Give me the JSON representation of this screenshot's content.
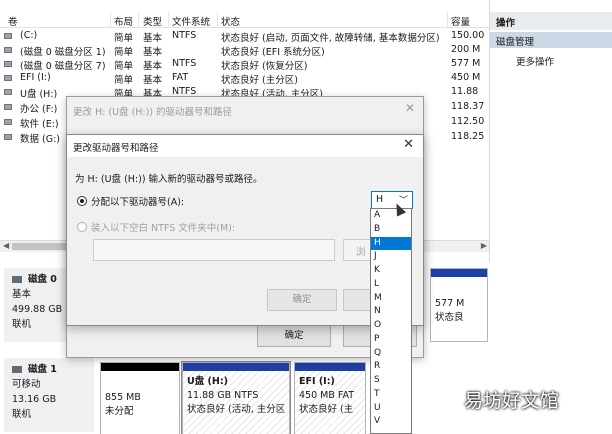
{
  "columns": [
    "卷",
    "布局",
    "类型",
    "文件系统",
    "状态",
    "容量"
  ],
  "volumes": [
    {
      "name": "(C:)",
      "layout": "简单",
      "type": "基本",
      "fs": "NTFS",
      "status": "状态良好 (启动, 页面文件, 故障转储, 基本数据分区)",
      "capacity": "150.00"
    },
    {
      "name": "(磁盘 0 磁盘分区 1)",
      "layout": "简单",
      "type": "基本",
      "fs": "",
      "status": "状态良好 (EFI 系统分区)",
      "capacity": "200 M"
    },
    {
      "name": "(磁盘 0 磁盘分区 7)",
      "layout": "简单",
      "type": "基本",
      "fs": "NTFS",
      "status": "状态良好 (恢复分区)",
      "capacity": "577 M"
    },
    {
      "name": "EFI (I:)",
      "layout": "简单",
      "type": "基本",
      "fs": "FAT",
      "status": "状态良好 (主分区)",
      "capacity": "450 M"
    },
    {
      "name": "U盘 (H:)",
      "layout": "简单",
      "type": "基本",
      "fs": "NTFS",
      "status": "状态良好 (活动, 主分区)",
      "capacity": "11.88"
    },
    {
      "name": "办公 (F:)",
      "layout": "",
      "type": "",
      "fs": "",
      "status": "",
      "capacity": "118.37"
    },
    {
      "name": "软件 (E:)",
      "layout": "",
      "type": "",
      "fs": "",
      "status": "",
      "capacity": "112.50"
    },
    {
      "name": "数据 (G:)",
      "layout": "",
      "type": "",
      "fs": "",
      "status": "",
      "capacity": "118.25"
    }
  ],
  "actions": {
    "header": "操作",
    "section": "磁盘管理",
    "more": "更多操作"
  },
  "disk0": {
    "name": "磁盘 0",
    "type": "基本",
    "size": "499.88 GB",
    "state": "联机",
    "partition_size": "577 M",
    "partition_status": "状态良"
  },
  "disk1": {
    "name": "磁盘 1",
    "type": "可移动",
    "size": "13.16 GB",
    "state": "联机"
  },
  "partitions": [
    {
      "title": "",
      "size": "855 MB",
      "status": "未分配"
    },
    {
      "title": "U盘 (H:)",
      "size": "11.88 GB NTFS",
      "status": "状态良好 (活动, 主分区"
    },
    {
      "title": "EFI (I:)",
      "size": "450 MB FAT",
      "status": "状态良好 (主"
    }
  ],
  "back_dialog": {
    "title": "更改 H: (U盘 (H:)) 的驱动器号和路径",
    "ok": "确定"
  },
  "dialog": {
    "title": "更改驱动器号和路径",
    "description": "为 H: (U盘 (H:)) 输入新的驱动器号或路径。",
    "option_assign": "分配以下驱动器号(A):",
    "option_mount": "装入以下空白 NTFS 文件夹中(M):",
    "browse_partial": "浏",
    "ok": "确定",
    "selected_letter": "H"
  },
  "letters": [
    "A",
    "B",
    "H",
    "J",
    "K",
    "L",
    "M",
    "N",
    "O",
    "P",
    "Q",
    "R",
    "S",
    "T",
    "U",
    "V"
  ],
  "watermark": "易坊好文馆"
}
